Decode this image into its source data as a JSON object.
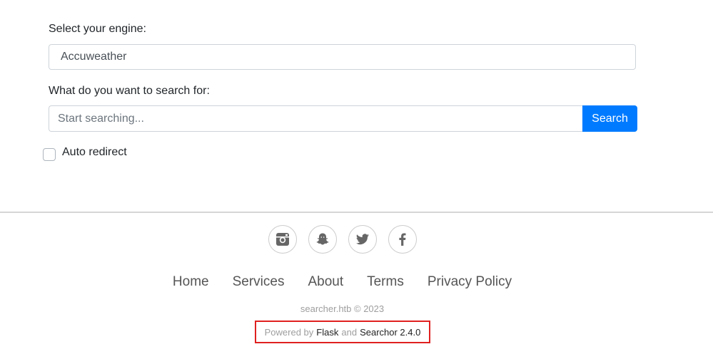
{
  "form": {
    "engine_label": "Select your engine:",
    "engine_value": "Accuweather",
    "query_label": "What do you want to search for:",
    "query_placeholder": "Start searching...",
    "search_button": "Search",
    "auto_redirect_label": "Auto redirect",
    "auto_redirect_checked": false
  },
  "footer": {
    "social": [
      "instagram-icon",
      "snapchat-icon",
      "twitter-icon",
      "facebook-icon"
    ],
    "nav": [
      "Home",
      "Services",
      "About",
      "Terms",
      "Privacy Policy"
    ],
    "copyright": "searcher.htb © 2023",
    "powered_prefix": "Powered by",
    "powered_flask": "Flask",
    "powered_and": "and",
    "powered_searchor": "Searchor 2.4.0"
  },
  "colors": {
    "accent": "#007bff",
    "highlight_box": "#e02020"
  }
}
